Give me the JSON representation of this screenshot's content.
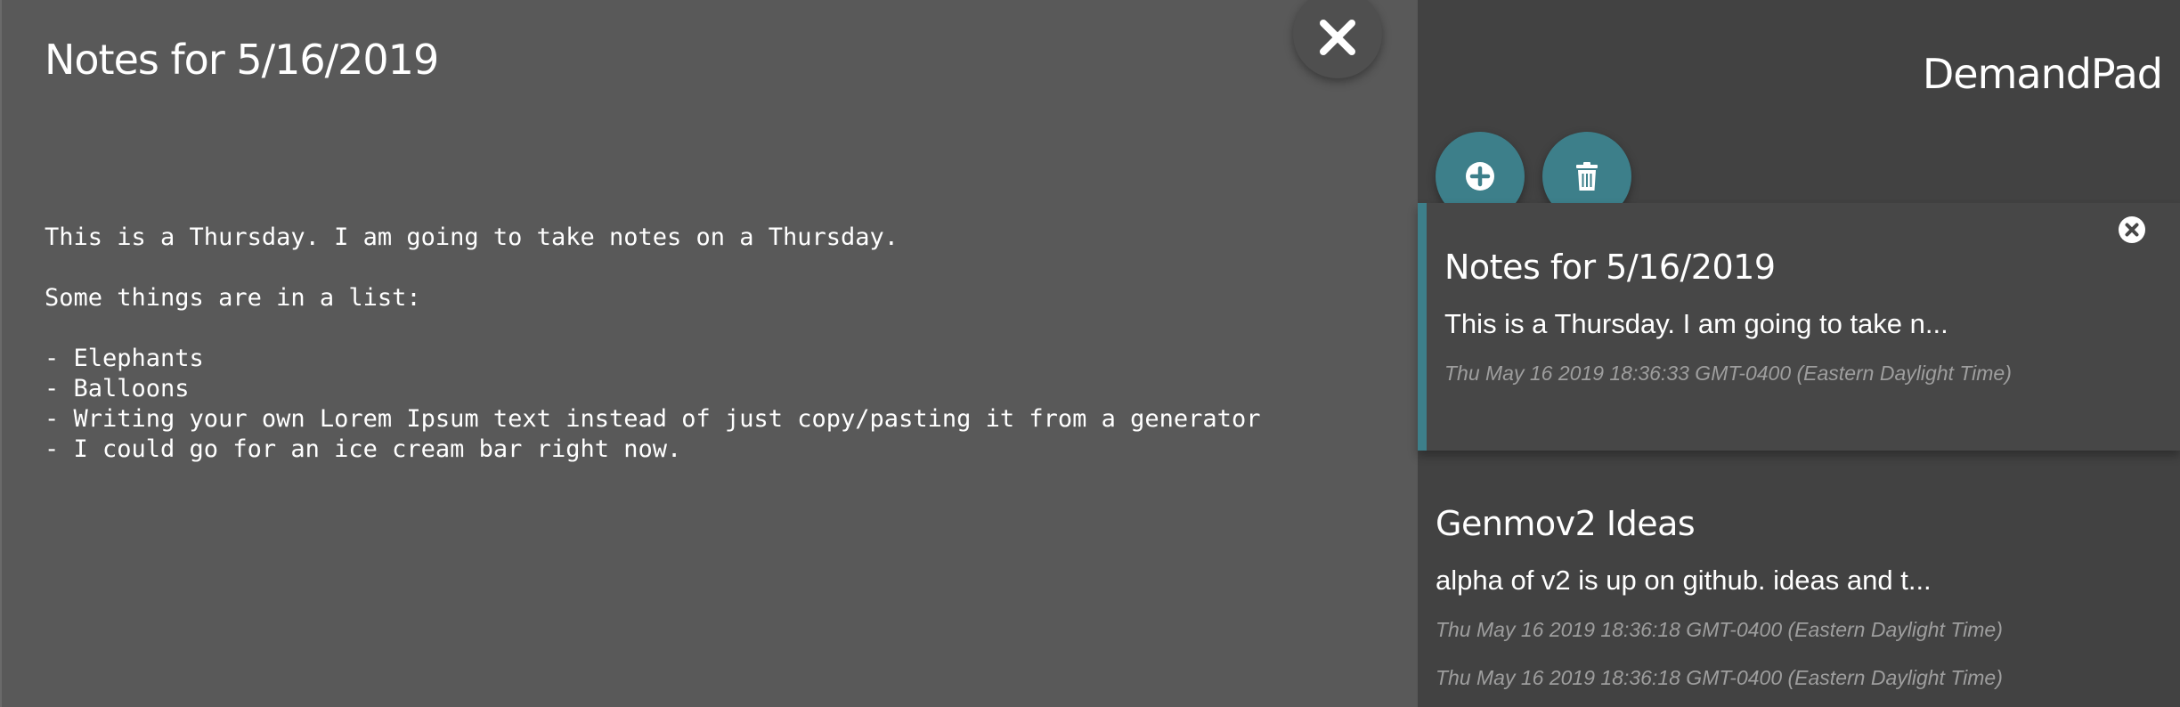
{
  "editor": {
    "title": "Notes for 5/16/2019",
    "body": "This is a Thursday. I am going to take notes on a Thursday.\n\nSome things are in a list:\n\n- Elephants\n- Balloons\n- Writing your own Lorem Ipsum text instead of just copy/pasting it from a generator\n- I could go for an ice cream bar right now.",
    "close_icon": "close-icon"
  },
  "sidebar": {
    "brand": "DemandPad",
    "add_icon": "plus-circle-icon",
    "delete_icon": "trash-icon",
    "accent_color": "#3d7f8a",
    "notes": [
      {
        "title": "Notes for 5/16/2019",
        "preview": "This is a Thursday. I am going to take n...",
        "date": "Thu May 16 2019 18:36:33 GMT-0400 (Eastern Daylight Time)",
        "active": true
      },
      {
        "title": "Genmov2 Ideas",
        "preview": "alpha of v2 is up on github. ideas and t...",
        "date": "Thu May 16 2019 18:36:18 GMT-0400 (Eastern Daylight Time)",
        "date2": "Thu May 16 2019 18:36:18 GMT-0400 (Eastern Daylight Time)",
        "active": false
      }
    ]
  }
}
